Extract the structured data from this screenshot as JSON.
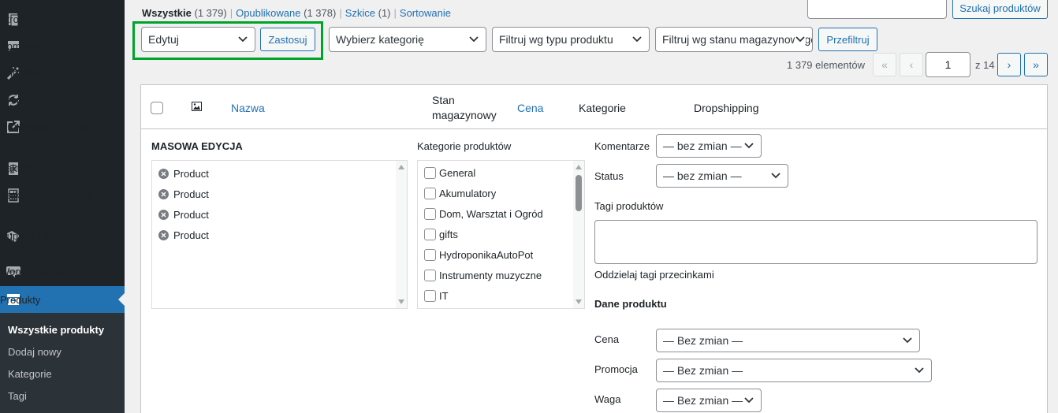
{
  "sidebar": {
    "items": [
      {
        "label": "Strony",
        "icon": "pages-icon"
      },
      {
        "label": "Komentarze",
        "icon": "comments-icon"
      },
      {
        "label": "ShopMagic",
        "icon": "magic-wand-icon"
      },
      {
        "label": "Dropshipping XML",
        "icon": "sync-icon"
      },
      {
        "label": "Dropshipping Export",
        "icon": "external-link-icon"
      },
      {
        "label": "Faktury",
        "icon": "invoice-icon"
      },
      {
        "label": "Kalkulator jednostek",
        "icon": "calculator-icon"
      },
      {
        "label": "Kupony PDF",
        "icon": "coupon-icon"
      },
      {
        "label": "WooCommerce",
        "icon": "woo-icon"
      },
      {
        "label": "Produkty",
        "icon": "archive-icon"
      }
    ],
    "submenu": [
      "Wszystkie produkty",
      "Dodaj nowy",
      "Kategorie",
      "Tagi"
    ]
  },
  "views": {
    "all": "Wszystkie",
    "all_count": "(1 379)",
    "published": "Opublikowane",
    "published_count": "(1 378)",
    "drafts": "Szkice",
    "drafts_count": "(1)",
    "sorting": "Sortowanie",
    "sep": "|"
  },
  "search": {
    "button": "Szukaj produktów"
  },
  "bulk": {
    "action": "Edytuj",
    "apply": "Zastosuj"
  },
  "filters": {
    "category": "Wybierz kategorię",
    "product_type": "Filtruj wg typu produktu",
    "stock": "Filtruj wg stanu magazynowego",
    "filter_button": "Przefiltruj"
  },
  "pagination": {
    "count": "1 379 elementów",
    "first": "«",
    "prev": "‹",
    "current": "1",
    "of": "z 14",
    "next": "›",
    "last": "»"
  },
  "table": {
    "col_name": "Nazwa",
    "col_stock_1": "Stan",
    "col_stock_2": "magazynowy",
    "col_price": "Cena",
    "col_categories": "Kategorie",
    "col_dropshipping": "Dropshipping"
  },
  "bulk_edit": {
    "title": "MASOWA EDYCJA",
    "products": [
      "Product",
      "Product",
      "Product",
      "Product"
    ],
    "categories_label": "Kategorie produktów",
    "categories": [
      "General",
      "Akumulatory",
      "Dom, Warsztat i Ogród",
      "gifts",
      "HydroponikaAutoPot",
      "Instrumenty muzyczne",
      "IT"
    ],
    "comments_label": "Komentarze",
    "comments_value": "— bez zmian —",
    "status_label": "Status",
    "status_value": "— bez zmian —",
    "tags_label": "Tagi produktów",
    "tags_hint": "Oddzielaj tagi przecinkami",
    "product_data_label": "Dane produktu",
    "price_label": "Cena",
    "price_value": "— Bez zmian —",
    "sale_label": "Promocja",
    "sale_value": "— Bez zmian —",
    "weight_label": "Waga",
    "weight_value": "— Bez zmian —"
  },
  "colors": {
    "accent": "#2271b1",
    "highlight": "#00a32a",
    "sidebar": "#1d2327"
  }
}
